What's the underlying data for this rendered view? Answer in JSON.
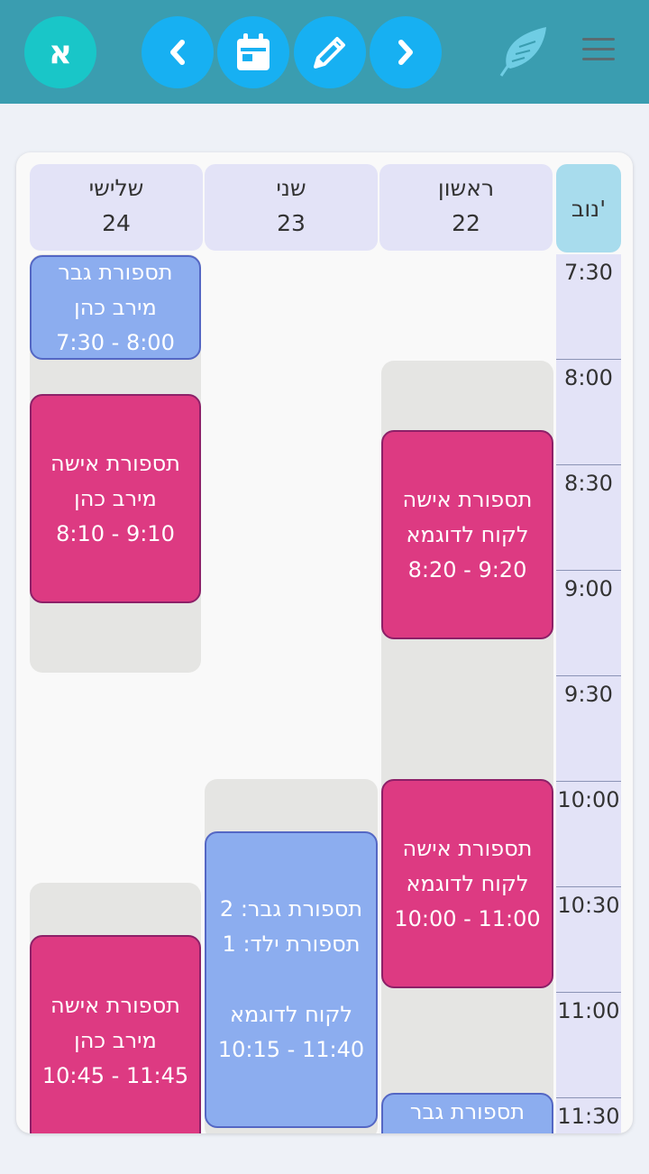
{
  "toolbar": {
    "lang_label": "א",
    "prev_icon": "chevron-left-icon",
    "calendar_icon": "calendar-icon",
    "edit_icon": "pencil-icon",
    "next_icon": "chevron-right-icon",
    "feather_icon": "feather-icon",
    "menu_icon": "hamburger-menu-icon"
  },
  "calendar": {
    "month_label": "נוב'",
    "days": [
      {
        "name": "שלישי",
        "num": "24"
      },
      {
        "name": "שני",
        "num": "23"
      },
      {
        "name": "ראשון",
        "num": "22"
      }
    ],
    "times": [
      "7:30",
      "8:00",
      "8:30",
      "9:00",
      "9:30",
      "10:00",
      "10:30",
      "11:00",
      "11:30"
    ],
    "appointments": {
      "tue_1": {
        "service": "תספורת גבר",
        "client": "מירב כהן",
        "time": "7:30 - 8:00"
      },
      "tue_2": {
        "service": "תספורת אישה",
        "client": "מירב כהן",
        "time": "8:10 - 9:10"
      },
      "tue_3": {
        "service": "תספורת אישה",
        "client": "מירב כהן",
        "time": "10:45 - 11:45"
      },
      "mon_1": {
        "service": "תספורת גבר: 2",
        "service2": "תספורת ילד: 1",
        "client": "לקוח לדוגמא",
        "time": "10:15 - 11:40"
      },
      "sun_1": {
        "service": "תספורת אישה",
        "client": "לקוח לדוגמא",
        "time": "8:20 - 9:20"
      },
      "sun_2": {
        "service": "תספורת אישה",
        "client": "לקוח לדוגמא",
        "time": "10:00 - 11:00"
      },
      "sun_3": {
        "service": "תספורת גבר"
      }
    }
  },
  "colors": {
    "topbar": "#3a9db0",
    "women_cut": "#dd3a82",
    "men_cut": "#8cadef",
    "nav_button": "#17b0f2"
  }
}
